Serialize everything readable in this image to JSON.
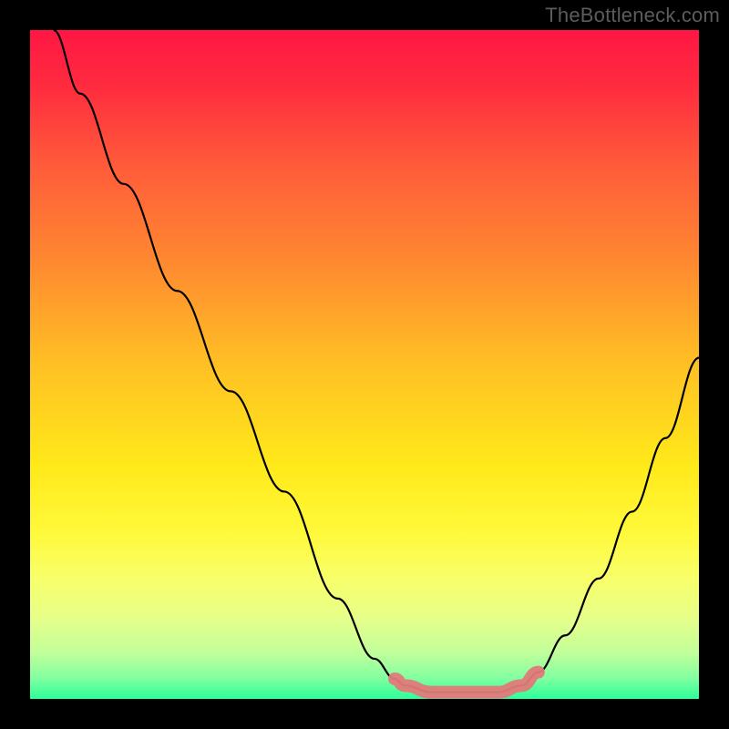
{
  "watermark": "TheBottleneck.com",
  "chart_data": {
    "type": "line",
    "title": "",
    "xlabel": "",
    "ylabel": "",
    "xlim": [
      0,
      1
    ],
    "ylim": [
      0,
      1
    ],
    "gradient_stops": [
      {
        "offset": 0.0,
        "color": "#ff1744"
      },
      {
        "offset": 0.08,
        "color": "#ff2a3f"
      },
      {
        "offset": 0.2,
        "color": "#ff5a3a"
      },
      {
        "offset": 0.35,
        "color": "#ff8a30"
      },
      {
        "offset": 0.5,
        "color": "#ffc024"
      },
      {
        "offset": 0.65,
        "color": "#ffe91a"
      },
      {
        "offset": 0.75,
        "color": "#fff93a"
      },
      {
        "offset": 0.82,
        "color": "#f8ff6a"
      },
      {
        "offset": 0.88,
        "color": "#e6ff8a"
      },
      {
        "offset": 0.93,
        "color": "#c2ff9a"
      },
      {
        "offset": 0.97,
        "color": "#80ffa0"
      },
      {
        "offset": 1.0,
        "color": "#2aff99"
      }
    ],
    "series": [
      {
        "name": "curve",
        "type": "line",
        "color": "#000000",
        "x": [
          0.035,
          0.075,
          0.14,
          0.22,
          0.3,
          0.38,
          0.46,
          0.515,
          0.545,
          0.56,
          0.6,
          0.7,
          0.735,
          0.76,
          0.8,
          0.85,
          0.9,
          0.95,
          1.0
        ],
        "y": [
          1.0,
          0.905,
          0.77,
          0.61,
          0.46,
          0.31,
          0.15,
          0.06,
          0.03,
          0.02,
          0.01,
          0.01,
          0.02,
          0.04,
          0.095,
          0.18,
          0.28,
          0.39,
          0.51
        ]
      },
      {
        "name": "flat-region",
        "type": "line",
        "color": "#e27a7a",
        "x": [
          0.545,
          0.56,
          0.6,
          0.65,
          0.7,
          0.735,
          0.76
        ],
        "y": [
          0.03,
          0.02,
          0.01,
          0.01,
          0.01,
          0.02,
          0.04
        ]
      }
    ]
  }
}
